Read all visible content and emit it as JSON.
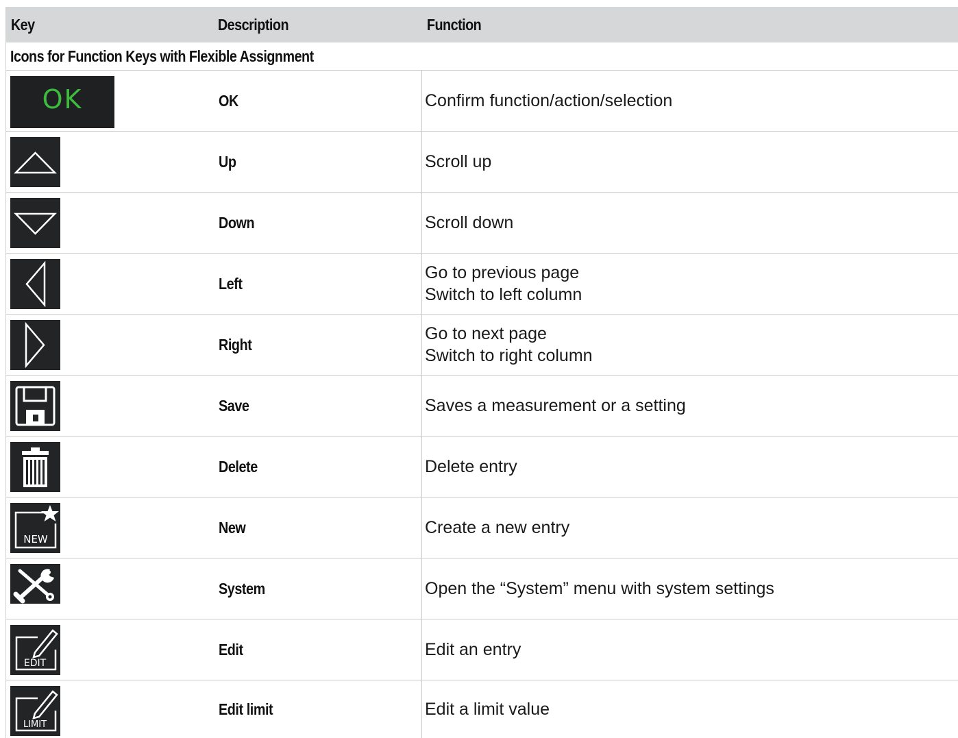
{
  "header": {
    "key": "Key",
    "description": "Description",
    "function": "Function"
  },
  "section_title": "Icons for Function Keys with Flexible Assignment",
  "rows": [
    {
      "icon": "ok-key-icon",
      "icon_text": "OK",
      "description": "OK",
      "function": [
        "Confirm function/action/selection"
      ]
    },
    {
      "icon": "up-arrow-icon",
      "description": "Up",
      "function": [
        "Scroll up"
      ]
    },
    {
      "icon": "down-arrow-icon",
      "description": "Down",
      "function": [
        "Scroll down"
      ]
    },
    {
      "icon": "left-arrow-icon",
      "description": "Left",
      "function": [
        "Go to previous page",
        "Switch to left column"
      ]
    },
    {
      "icon": "right-arrow-icon",
      "description": "Right",
      "function": [
        "Go to next page",
        "Switch to right column"
      ]
    },
    {
      "icon": "save-icon",
      "description": "Save",
      "function": [
        "Saves a measurement or a setting"
      ]
    },
    {
      "icon": "delete-icon",
      "description": "Delete",
      "function": [
        "Delete entry"
      ]
    },
    {
      "icon": "new-icon",
      "icon_text": "NEW",
      "description": "New",
      "function": [
        "Create a new entry"
      ]
    },
    {
      "icon": "system-icon",
      "description": "System",
      "function": [
        "Open the “System” menu with system settings"
      ]
    },
    {
      "icon": "edit-icon",
      "icon_text": "EDIT",
      "description": "Edit",
      "function": [
        "Edit an entry"
      ]
    },
    {
      "icon": "edit-limit-icon",
      "icon_text": "LIMIT",
      "description": "Edit limit",
      "function": [
        "Edit a limit value"
      ]
    }
  ],
  "colors": {
    "header_bg": "#d6d7d9",
    "icon_bg": "#222426",
    "ok_green": "#3dbb3d"
  }
}
